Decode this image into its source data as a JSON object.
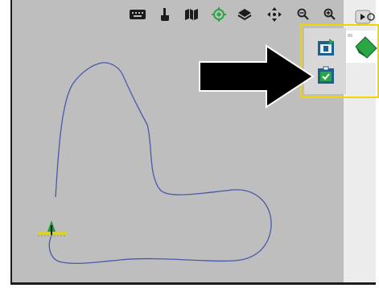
{
  "toolbar": {
    "icons": [
      "keyboard-icon",
      "touch-icon",
      "map-style-icon",
      "target-icon",
      "layers-icon",
      "pan-icon",
      "zoom-out-icon",
      "zoom-in-icon",
      "info-icon"
    ]
  },
  "map": {
    "field_boundary": "field-boundary-line",
    "vehicle": "vehicle-icon"
  },
  "popup": {
    "buttons": [
      "task-calendar-icon",
      "task-check-icon",
      "green-tab-icon"
    ]
  },
  "colors": {
    "map_background": "#bebebe",
    "boundary": "#4a58a8",
    "highlight": "#f2d500",
    "arrow": "#000000",
    "accent_green": "#2aa745",
    "button_blue": "#1f5f8b"
  }
}
